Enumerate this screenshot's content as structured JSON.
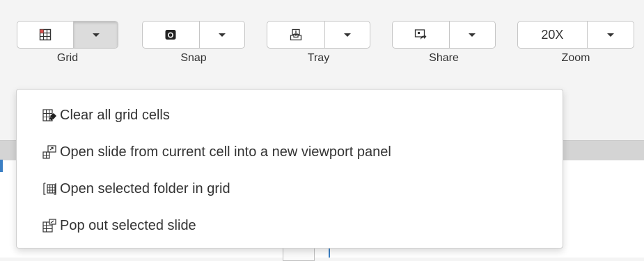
{
  "toolbar": {
    "groups": [
      {
        "label": "Grid",
        "icon": "grid-icon"
      },
      {
        "label": "Snap",
        "icon": "camera-icon"
      },
      {
        "label": "Tray",
        "icon": "tray-icon"
      },
      {
        "label": "Share",
        "icon": "share-icon"
      },
      {
        "label": "Zoom",
        "value": "20X"
      }
    ]
  },
  "grid_menu": {
    "items": [
      {
        "label": "Clear all grid cells",
        "icon": "clear-grid-icon"
      },
      {
        "label": "Open slide from current cell into a new viewport panel",
        "icon": "open-in-viewport-icon"
      },
      {
        "label": "Open selected folder in grid",
        "icon": "folder-grid-icon"
      },
      {
        "label": "Pop out selected slide",
        "icon": "pop-out-icon"
      }
    ]
  },
  "colors": {
    "accent": "#3b7fc4",
    "grid_icon_red": "#d9534f"
  }
}
